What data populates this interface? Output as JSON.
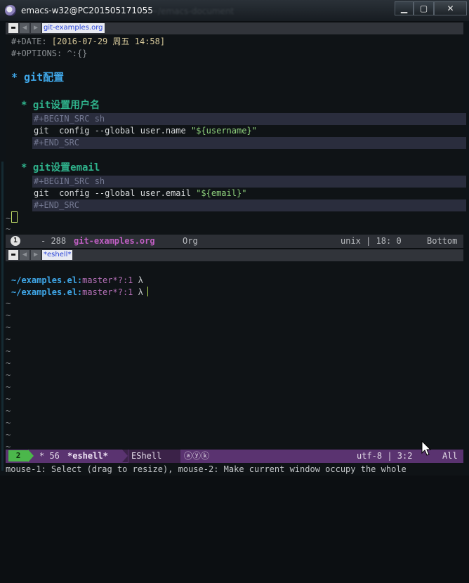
{
  "window": {
    "title": "emacs-w32@PC201505171055",
    "title_ghost": "~/emacs-document",
    "minimize": "▁",
    "maximize": "▢",
    "close": "✕"
  },
  "top_pane": {
    "header": {
      "close": "▬",
      "prev": "◀",
      "next": "▶",
      "tab": "git-examples.org"
    },
    "lines": {
      "date_key": "#+DATE: ",
      "date_value": "[2016-07-29 周五 14:58]",
      "options": "#+OPTIONS: ^:{}",
      "h1": "* git配置",
      "h2a": "* git设置用户名",
      "begin_src_a": "#+BEGIN_SRC sh",
      "code_a": "git  config --global user.name ",
      "code_a_str": "\"${username}\"",
      "end_src_a": "#+END_SRC",
      "h2b": "* git设置email",
      "begin_src_b": "#+BEGIN_SRC sh",
      "code_b": "git  config --global user.email ",
      "code_b_str": "\"${email}\"",
      "end_src_b": "#+END_SRC",
      "tilde": "~"
    }
  },
  "top_modeline": {
    "window_number": "1",
    "status": "- 288",
    "buffer_name": "git-examples.org",
    "mode": "Org",
    "encoding": "unix | 18: 0",
    "position": "Bottom"
  },
  "bottom_pane": {
    "header": {
      "close": "▬",
      "prev": "◀",
      "next": "▶",
      "tab": "*eshell*"
    },
    "prompt_path": "~/examples.el:",
    "prompt_branch": "master*?:1",
    "prompt_symbol": "λ",
    "tilde": "~"
  },
  "bottom_modeline": {
    "window_number": "2",
    "status": "* 56",
    "buffer_name": "*eshell*",
    "mode": "EShell",
    "minor_modes": "ⓐⓨⓚ",
    "encoding": "utf-8 | 3:2",
    "position": "All"
  },
  "echo_area": {
    "text": "mouse-1: Select (drag to resize), mouse-2: Make current window occupy the whole"
  },
  "colors": {
    "org_level_1": "#3fa7e8",
    "org_level_2": "#2fb38c",
    "string": "#8fd27d",
    "modeline_active": "#5a3370",
    "window_number_active": "#4bb74b"
  }
}
